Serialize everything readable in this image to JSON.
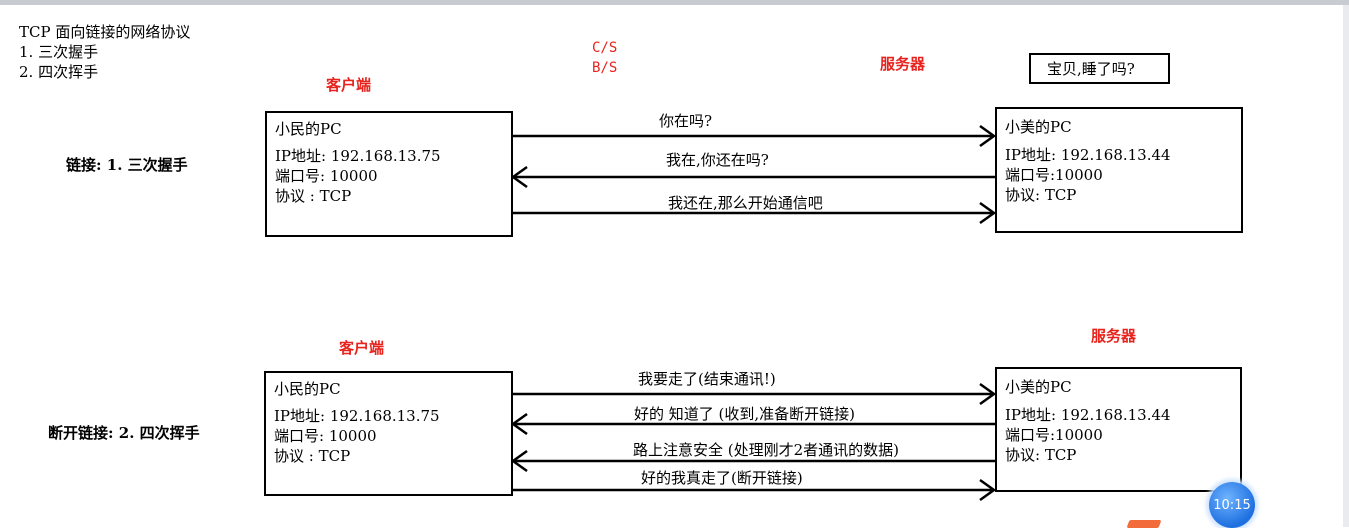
{
  "header": {
    "title": "TCP 面向链接的网络协议",
    "item1": "1. 三次握手",
    "item2": "2. 四次挥手"
  },
  "models": {
    "cs": "C/S",
    "bs": "B/S"
  },
  "handshake": {
    "row_label": "链接: 1. 三次握手",
    "client_label": "客户端",
    "server_label": "服务器",
    "server_speech": "宝贝,睡了吗?",
    "client": {
      "name": "小民的PC",
      "ip": "IP地址: 192.168.13.75",
      "port": "端口号: 10000",
      "protocol": "协议 : TCP"
    },
    "server": {
      "name": "小美的PC",
      "ip": "IP地址: 192.168.13.44",
      "port": "端口号:10000",
      "protocol": "协议: TCP"
    },
    "messages": [
      "你在吗?",
      "我在,你还在吗?",
      "我还在,那么开始通信吧"
    ]
  },
  "wave": {
    "row_label": "断开链接: 2. 四次挥手",
    "client_label": "客户端",
    "server_label": "服务器",
    "client": {
      "name": "小民的PC",
      "ip": "IP地址: 192.168.13.75",
      "port": "端口号: 10000",
      "protocol": "协议 : TCP"
    },
    "server": {
      "name": "小美的PC",
      "ip": "IP地址: 192.168.13.44",
      "port": "端口号:10000",
      "protocol": "协议: TCP"
    },
    "messages": [
      "我要走了(结束通讯!)",
      "好的 知道了 (收到,准备断开链接)",
      "路上注意安全 (处理刚才2者通讯的数据)",
      "好的我真走了(断开链接)"
    ]
  },
  "clock_widget": {
    "time": "10:15"
  }
}
